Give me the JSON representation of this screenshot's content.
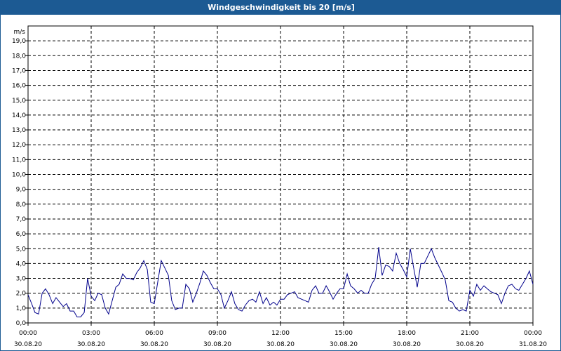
{
  "window": {
    "title": "Windgeschwindigkeit bis 20 [m/s]"
  },
  "chart_data": {
    "type": "line",
    "title": "Windgeschwindigkeit bis 20 [m/s]",
    "ylabel": "m/s",
    "ylim": [
      0,
      20
    ],
    "yticks": [
      "0,0",
      "1,0",
      "2,0",
      "3,0",
      "4,0",
      "5,0",
      "6,0",
      "7,0",
      "8,0",
      "9,0",
      "10,0",
      "11,0",
      "12,0",
      "13,0",
      "14,0",
      "15,0",
      "16,0",
      "17,0",
      "18,0",
      "19,0"
    ],
    "xlim_hours": [
      0,
      24
    ],
    "xticks": [
      {
        "hour": 0,
        "time": "00:00",
        "date": "30.08.20"
      },
      {
        "hour": 3,
        "time": "03:00",
        "date": "30.08.20"
      },
      {
        "hour": 6,
        "time": "06:00",
        "date": "30.08.20"
      },
      {
        "hour": 9,
        "time": "09:00",
        "date": "30.08.20"
      },
      {
        "hour": 12,
        "time": "12:00",
        "date": "30.08.20"
      },
      {
        "hour": 15,
        "time": "15:00",
        "date": "30.08.20"
      },
      {
        "hour": 18,
        "time": "18:00",
        "date": "30.08.20"
      },
      {
        "hour": 21,
        "time": "21:00",
        "date": "30.08.20"
      },
      {
        "hour": 24,
        "time": "00:00",
        "date": "31.08.20"
      }
    ],
    "grid": true,
    "line_color": "#00008b",
    "series": [
      {
        "x": [
          0.0,
          0.17,
          0.33,
          0.5,
          0.67,
          0.83,
          1.0,
          1.17,
          1.33,
          1.5,
          1.67,
          1.83,
          2.0,
          2.17,
          2.33,
          2.5,
          2.67,
          2.83,
          3.0,
          3.17,
          3.33,
          3.5,
          3.67,
          3.83,
          4.0,
          4.17,
          4.33,
          4.5,
          4.67,
          4.83,
          5.0,
          5.17,
          5.33,
          5.5,
          5.67,
          5.83,
          6.0,
          6.17,
          6.33,
          6.5,
          6.67,
          6.83,
          7.0,
          7.17,
          7.33,
          7.5,
          7.67,
          7.83,
          8.0,
          8.17,
          8.33,
          8.5,
          8.67,
          8.83,
          9.0,
          9.17,
          9.33,
          9.5,
          9.67,
          9.83,
          10.0,
          10.17,
          10.33,
          10.5,
          10.67,
          10.83,
          11.0,
          11.17,
          11.33,
          11.5,
          11.67,
          11.83,
          12.0,
          12.17,
          12.33,
          12.5,
          12.67,
          12.83,
          13.0,
          13.17,
          13.33,
          13.5,
          13.67,
          13.83,
          14.0,
          14.17,
          14.33,
          14.5,
          14.67,
          14.83,
          15.0,
          15.17,
          15.33,
          15.5,
          15.67,
          15.83,
          16.0,
          16.17,
          16.33,
          16.5,
          16.67,
          16.83,
          17.0,
          17.17,
          17.33,
          17.5,
          17.67,
          17.83,
          18.0,
          18.17,
          18.33,
          18.5,
          18.67,
          18.83,
          19.0,
          19.17,
          19.33,
          19.5,
          19.67,
          19.83,
          20.0,
          20.17,
          20.33,
          20.5,
          20.67,
          20.83,
          21.0,
          21.17,
          21.33,
          21.5,
          21.67,
          21.83,
          22.0,
          22.17,
          22.33,
          22.5,
          22.67,
          22.83,
          23.0,
          23.17,
          23.33,
          23.5,
          23.67,
          23.83,
          24.0
        ],
        "y": [
          1.9,
          1.3,
          0.7,
          0.6,
          2.0,
          2.3,
          1.9,
          1.3,
          1.7,
          1.4,
          1.1,
          1.3,
          0.8,
          0.8,
          0.4,
          0.4,
          0.7,
          3.0,
          1.8,
          1.5,
          2.0,
          1.9,
          1.0,
          0.6,
          1.5,
          2.4,
          2.6,
          3.3,
          3.0,
          3.0,
          2.9,
          3.4,
          3.7,
          4.2,
          3.6,
          1.4,
          1.3,
          2.8,
          4.2,
          3.7,
          3.2,
          1.5,
          0.9,
          1.0,
          1.0,
          2.6,
          2.3,
          1.4,
          2.0,
          2.7,
          3.5,
          3.2,
          2.7,
          2.3,
          2.3,
          1.9,
          1.0,
          1.5,
          2.1,
          1.3,
          0.9,
          0.8,
          1.2,
          1.5,
          1.6,
          1.4,
          2.1,
          1.3,
          1.7,
          1.2,
          1.4,
          1.2,
          1.6,
          1.6,
          1.9,
          2.0,
          2.1,
          1.7,
          1.6,
          1.5,
          1.4,
          2.2,
          2.5,
          2.0,
          2.0,
          2.5,
          2.1,
          1.6,
          2.0,
          2.3,
          2.3,
          3.3,
          2.5,
          2.3,
          2.0,
          2.2,
          2.0,
          2.0,
          2.6,
          3.0,
          5.1,
          3.2,
          3.9,
          3.8,
          3.5,
          4.7,
          4.0,
          3.6,
          3.1,
          5.0,
          3.7,
          2.4,
          4.0,
          4.0,
          4.5,
          5.0,
          4.4,
          3.9,
          3.4,
          2.9,
          1.5,
          1.4,
          1.0,
          0.8,
          0.9,
          0.8,
          2.2,
          1.8,
          2.6,
          2.2,
          2.5,
          2.3,
          2.1,
          2.0,
          1.9,
          1.3,
          2.0,
          2.5,
          2.6,
          2.3,
          2.2,
          2.6,
          3.0,
          3.5,
          2.6
        ]
      }
    ]
  }
}
